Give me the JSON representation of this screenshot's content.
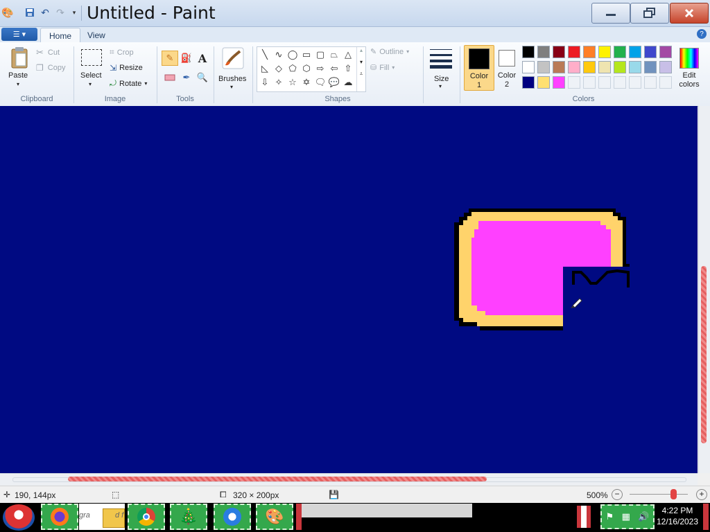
{
  "window": {
    "title": "Untitled - Paint"
  },
  "ribbon": {
    "tabs": [
      "Home",
      "View"
    ],
    "clipboard": {
      "paste": "Paste",
      "cut": "Cut",
      "copy": "Copy",
      "group": "Clipboard"
    },
    "image": {
      "select": "Select",
      "crop": "Crop",
      "resize": "Resize",
      "rotate": "Rotate",
      "group": "Image"
    },
    "tools": {
      "group": "Tools"
    },
    "brushes": {
      "label": "Brushes"
    },
    "shapes": {
      "outline": "Outline",
      "fill": "Fill",
      "group": "Shapes"
    },
    "size": {
      "label": "Size"
    },
    "colors": {
      "color1_line1": "Color",
      "color1_line2": "1",
      "color2_line1": "Color",
      "color2_line2": "2",
      "edit_line1": "Edit",
      "edit_line2": "colors",
      "group": "Colors",
      "color1_value": "#000000",
      "color2_value": "#ffffff",
      "palette_row1": [
        "#000000",
        "#7f7f7f",
        "#880015",
        "#ed1c24",
        "#ff7f27",
        "#fff200",
        "#22b14c",
        "#00a2e8",
        "#3f48cc",
        "#a349a4"
      ],
      "palette_row2": [
        "#ffffff",
        "#c3c3c3",
        "#b97a57",
        "#ffaec9",
        "#ffc90e",
        "#efe4b0",
        "#b5e61d",
        "#99d9ea",
        "#7092be",
        "#c8bfe7"
      ],
      "palette_row3": [
        "#000080",
        "#ffe070",
        "#ff40ff",
        "",
        "",
        "",
        "",
        "",
        "",
        ""
      ]
    }
  },
  "canvas": {
    "background": "#000a82",
    "shape_border": "#000000",
    "shape_outer": "#ffd36b",
    "shape_inner": "#ff40ff"
  },
  "status": {
    "cursor_position": "190, 144px",
    "image_size": "320 × 200px",
    "zoom": "500%"
  },
  "taskbar": {
    "label_fragment": "gra",
    "label_fragment2": "d f",
    "time": "4:22 PM",
    "date": "12/16/2023"
  }
}
